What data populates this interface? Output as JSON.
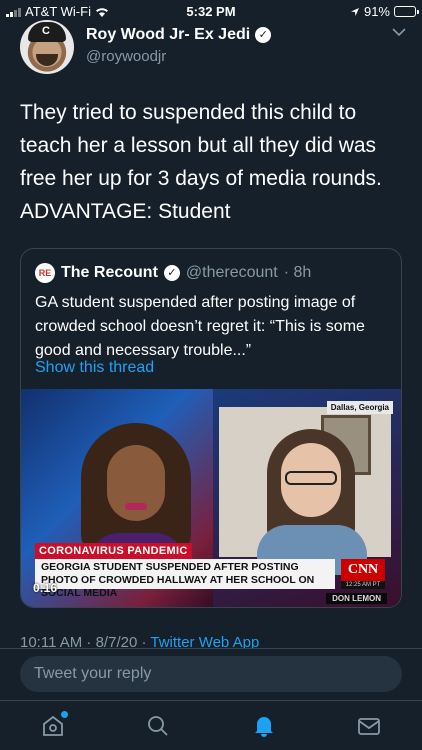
{
  "status_bar": {
    "carrier": "AT&T Wi-Fi",
    "time": "5:32 PM",
    "battery": "91%",
    "battery_level": 0.91
  },
  "tweet": {
    "author_name": "Roy Wood Jr- Ex Jedi",
    "author_handle": "@roywoodjr",
    "text": "They tried to suspended this child to teach her a lesson but all they did was free her up for 3 days of media rounds. ADVANTAGE: Student",
    "timestamp": "10:11 AM · 8/7/20 · ",
    "source": "Twitter Web App"
  },
  "quoted_tweet": {
    "logo_text": "RE",
    "author_name": "The Recount",
    "author_handle": "@therecount",
    "age": "· 8h",
    "text": "GA student suspended after posting image of crowded school doesn’t regret it: “This is some good and necessary trouble...”",
    "show_thread": "Show this thread",
    "video": {
      "dateline": "Dallas, Georgia",
      "banner_top": "CORONAVIRUS PANDEMIC",
      "banner_main": "GEORGIA STUDENT SUSPENDED AFTER POSTING PHOTO OF CROWDED HALLWAY AT HER SCHOOL ON SOCIAL MEDIA",
      "network": "CNN",
      "network_time": "12:25 AM PT",
      "anchor_name": "DON LEMON",
      "duration": "0:16"
    }
  },
  "reply": {
    "placeholder": "Tweet your reply"
  },
  "tab_bar": {
    "tabs": [
      "home",
      "search",
      "notifications",
      "messages"
    ],
    "active_color": "#1da1f2",
    "inactive_color": "#8899a6"
  }
}
